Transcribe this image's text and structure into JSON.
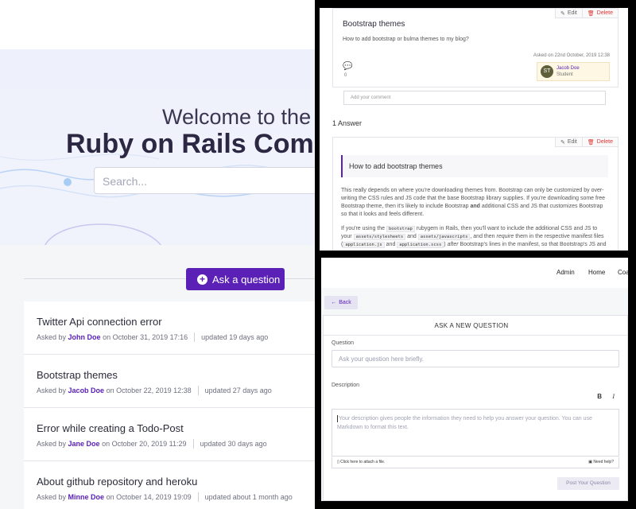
{
  "left": {
    "hero": {
      "line1": "Welcome to the",
      "line2": "Ruby on Rails Comm",
      "search_placeholder": "Search..."
    },
    "ask_button": "Ask a question",
    "questions": [
      {
        "title": "Twitter Api connection error",
        "asked_by": "Asked by",
        "author": "John Doe",
        "on": "on October 31, 2019 17:16",
        "updated": "updated 19 days ago"
      },
      {
        "title": "Bootstrap themes",
        "asked_by": "Asked by",
        "author": "Jacob Doe",
        "on": "on October 22, 2019 12:38",
        "updated": "updated 27 days ago"
      },
      {
        "title": "Error while creating a Todo-Post",
        "asked_by": "Asked by",
        "author": "Jane Doe",
        "on": "on October 20, 2019 11:29",
        "updated": "updated 30 days ago"
      },
      {
        "title": "About github repository and heroku",
        "asked_by": "Asked by",
        "author": "Minne Doe",
        "on": "on October 14, 2019 19:09",
        "updated": "updated about 1 month ago"
      }
    ]
  },
  "question_view": {
    "edit": "Edit",
    "delete": "Delete",
    "title": "Bootstrap themes",
    "body": "How to add bootstrap or bulma themes to my blog?",
    "asked_on": "Asked on 22nd October, 2019 12:38",
    "votes": "0",
    "author_initials": "ST",
    "author_name": "Jacob Doe",
    "author_role": "Student",
    "comment_placeholder": "Add your comment",
    "answers_count": "1 Answer",
    "answer": {
      "heading": "How to add bootstrap themes",
      "p1": "This really depends on where you're downloading themes from. Bootstrap can only be customized by over-writing the CSS rules and JS code that the base Bootstrap library supplies. If you're downloading some free Bootstrap theme, then it's likely to include Bootstrap",
      "p1_bold": "and",
      "p1_end": "additional CSS and JS that customizes Bootstrap so that it looks and feels different.",
      "p2_a": "If you're using the",
      "p2_code1": "bootstrap",
      "p2_b": "rubygem in Rails, then you'll want to include the additional CSS and JS to your",
      "p2_code2": "assets/stylesheets",
      "p2_c": "and",
      "p2_code3": "assets/javascripts",
      "p2_d": ", and then",
      "p2_em": "require",
      "p2_e": "them in the respective manifest files (",
      "p2_code4": "application.js",
      "p2_f": "and",
      "p2_code5": "application.scss",
      "p2_g": ")",
      "p2_em2": "after",
      "p2_h": "Bootstrap's lines in the manifest, so that Bootstrap's JS and"
    }
  },
  "new_question": {
    "nav": [
      "Admin",
      "Home",
      "Coa"
    ],
    "back": "Back",
    "title": "ASK A NEW QUESTION",
    "question_label": "Question",
    "question_placeholder": "Ask your question here briefly.",
    "description_label": "Description",
    "bold": "B",
    "italic": "I",
    "description_placeholder": "Your description gives people the information they need to help you answer your question. You can use Markdown to format this text.",
    "attach": "Click here to attach a file.",
    "help": "Need help?",
    "submit": "Post Your Question"
  },
  "colors": {
    "accent": "#5b21b6",
    "hero_bg": "#eef0fb",
    "delete": "#dd3333"
  }
}
